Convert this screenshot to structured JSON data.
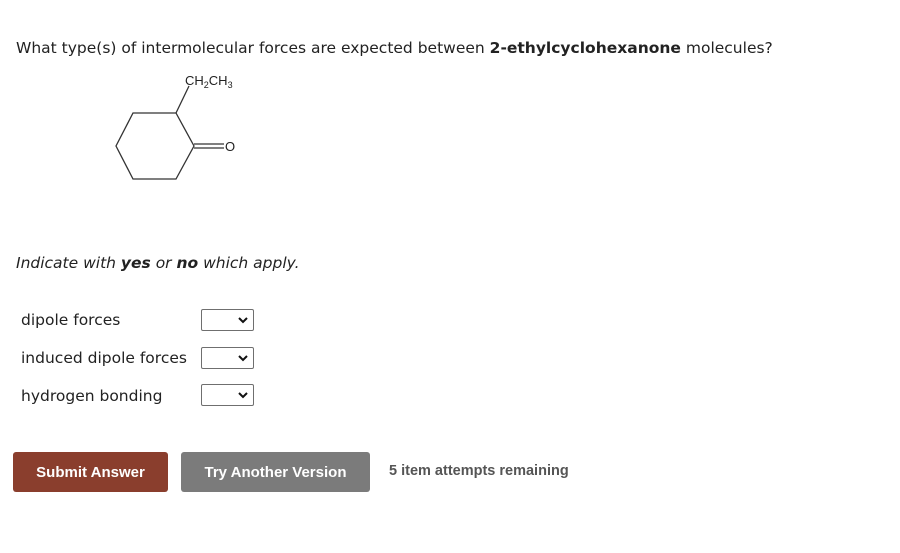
{
  "question": {
    "prefix": "What type(s) of intermolecular forces are expected between ",
    "compound": "2-ethylcyclohexanone",
    "suffix": " molecules?"
  },
  "molecule": {
    "substituent_label": "CH2CH3",
    "oxygen_label": "O"
  },
  "instruction": {
    "part1": "Indicate with ",
    "yes": "yes",
    "part2": " or ",
    "no": "no",
    "part3": " which apply."
  },
  "rows": [
    {
      "label": "dipole forces",
      "selected": ""
    },
    {
      "label": "induced dipole forces",
      "selected": ""
    },
    {
      "label": "hydrogen bonding",
      "selected": ""
    }
  ],
  "buttons": {
    "submit": "Submit Answer",
    "try_another": "Try Another Version"
  },
  "attempts_text": "5 item attempts remaining"
}
